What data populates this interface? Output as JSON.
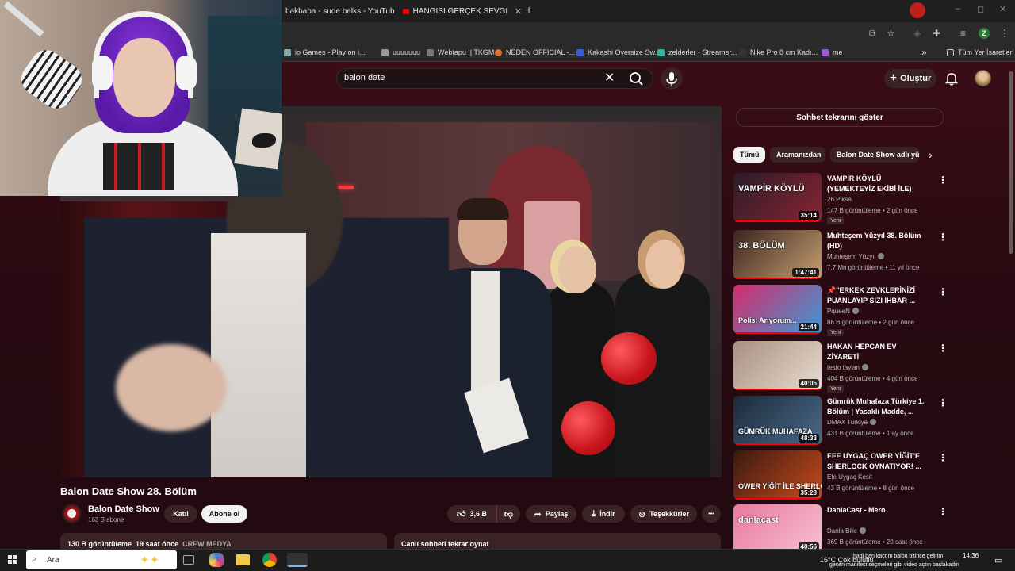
{
  "browser": {
    "tabs": [
      {
        "label": "bakbaba - sude belks - YouTub"
      },
      {
        "label": "HANGİSİ GERÇEK SEVGİLİM ? (S"
      }
    ],
    "tab_add": "+",
    "bookmarks": [
      {
        "label": "io Games - Play on i...",
        "color": "#8aa"
      },
      {
        "label": "uuuuuuu",
        "color": "#999"
      },
      {
        "label": "Webtapu || TKGM",
        "color": "#777"
      },
      {
        "label": "NEDEN OFFICIAL -...",
        "color": "#e0702c"
      },
      {
        "label": "Kakashi Oversize Sw...",
        "color": "#3a5ad8"
      },
      {
        "label": "zelderler - Streamer...",
        "color": "#2ab5a0"
      },
      {
        "label": "Nike Pro 8 cm Kadı...",
        "color": "#333"
      },
      {
        "label": "me",
        "color": "#9a5ad8"
      }
    ],
    "bookmarks_more": "»",
    "all_bookmarks": "Tüm Yer İşaretleri",
    "profile_initial": "Z"
  },
  "youtube": {
    "search": {
      "query": "balon date"
    },
    "create_label": "Oluştur",
    "video": {
      "title": "Balon Date Show 28. Bölüm",
      "channel": "Balon Date Show",
      "subscribers": "163 B abone",
      "join_label": "Katıl",
      "subscribe_label": "Abone ol",
      "likes": "3,6 B",
      "share_label": "Paylaş",
      "download_label": "İndir",
      "thanks_label": "Teşekkürler",
      "more_label": "•••",
      "views": "130 B görüntüleme",
      "age": "19 saat önce",
      "tag": "CREW MEDYA",
      "chat_replay_label": "Canlı sohbeti tekrar oynat"
    },
    "sidebar": {
      "show_chat_replay": "Sohbet tekrarını göster",
      "chips": [
        {
          "label": "Tümü"
        },
        {
          "label": "Aramanızdan"
        },
        {
          "label": "Balon Date Show adlı yü"
        }
      ],
      "recommendations": [
        {
          "title": "VAMPİR KÖYLÜ (YEMEKTEYİZ EKİBİ İLE)",
          "channel": "26 Piksel",
          "verified": false,
          "meta": "147 B görüntüleme • 2 gün önce",
          "badge": "Yeni",
          "duration": "35:14",
          "thumb_text": "VAMPİR KÖYLÜ",
          "colors": [
            "#2a1c2a",
            "#8a2430"
          ]
        },
        {
          "title": "Muhteşem Yüzyıl 38. Bölüm (HD)",
          "channel": "Muhteşem Yüzyıl",
          "verified": true,
          "meta": "7,7 Mn görüntüleme • 11 yıl önce",
          "badge": "",
          "duration": "1:47:41",
          "thumb_text": "38. BÖLÜM",
          "colors": [
            "#3a2420",
            "#c8a070"
          ]
        },
        {
          "title": "📌\"ERKEK ZEVKLERİNİZİ PUANLAYIP SİZİ İHBAR ...",
          "channel": "PqueeN",
          "verified": true,
          "meta": "86 B görüntüleme • 2 gün önce",
          "badge": "Yeni",
          "duration": "21:44",
          "thumb_text": "Polisi Arıyorum...",
          "colors": [
            "#d82a6a",
            "#3a9ad8"
          ]
        },
        {
          "title": "HAKAN HEPCAN EV ZİYARETİ",
          "channel": "testo taylan",
          "verified": true,
          "meta": "404 B görüntüleme • 4 gün önce",
          "badge": "Yeni",
          "duration": "40:05",
          "thumb_text": "",
          "colors": [
            "#a89080",
            "#e8dcd0"
          ]
        },
        {
          "title": "Gümrük Muhafaza Türkiye 1. Bölüm | Yasaklı Madde, ...",
          "channel": "DMAX Turkiye",
          "verified": true,
          "meta": "431 B görüntüleme • 1 ay önce",
          "badge": "",
          "duration": "48:33",
          "thumb_text": "GÜMRÜK MUHAFAZA",
          "colors": [
            "#1c2a3a",
            "#4a6a8a"
          ]
        },
        {
          "title": "EFE UYGAÇ OWER YİĞİT'E SHERLOCK OYNATIYOR! ...",
          "channel": "Efe Uygaç Kesit",
          "verified": false,
          "meta": "43 B görüntüleme • 8 gün önce",
          "badge": "",
          "duration": "35:28",
          "thumb_text": "OWER YİĞİT İLE SHERLOCK!",
          "colors": [
            "#3a1a10",
            "#c84a1c"
          ]
        },
        {
          "title": "DanlaCast - Mero",
          "channel": "Danla Bilic",
          "verified": true,
          "meta": "369 B görüntüleme • 20 saat önce",
          "badge": "Yeni",
          "duration": "40:56",
          "thumb_text": "danlacast",
          "colors": [
            "#e87aa0",
            "#f8c0d0"
          ]
        }
      ]
    }
  },
  "taskbar": {
    "search_placeholder": "Ara",
    "weather": "16°C  Çok bulutlu",
    "notification_line1": "hadi ben kaçtım balon bitince gelirim",
    "notification_line2": "geçen manifest seçmeleri gibi video açtın başlakadın",
    "clock": "14:36"
  }
}
